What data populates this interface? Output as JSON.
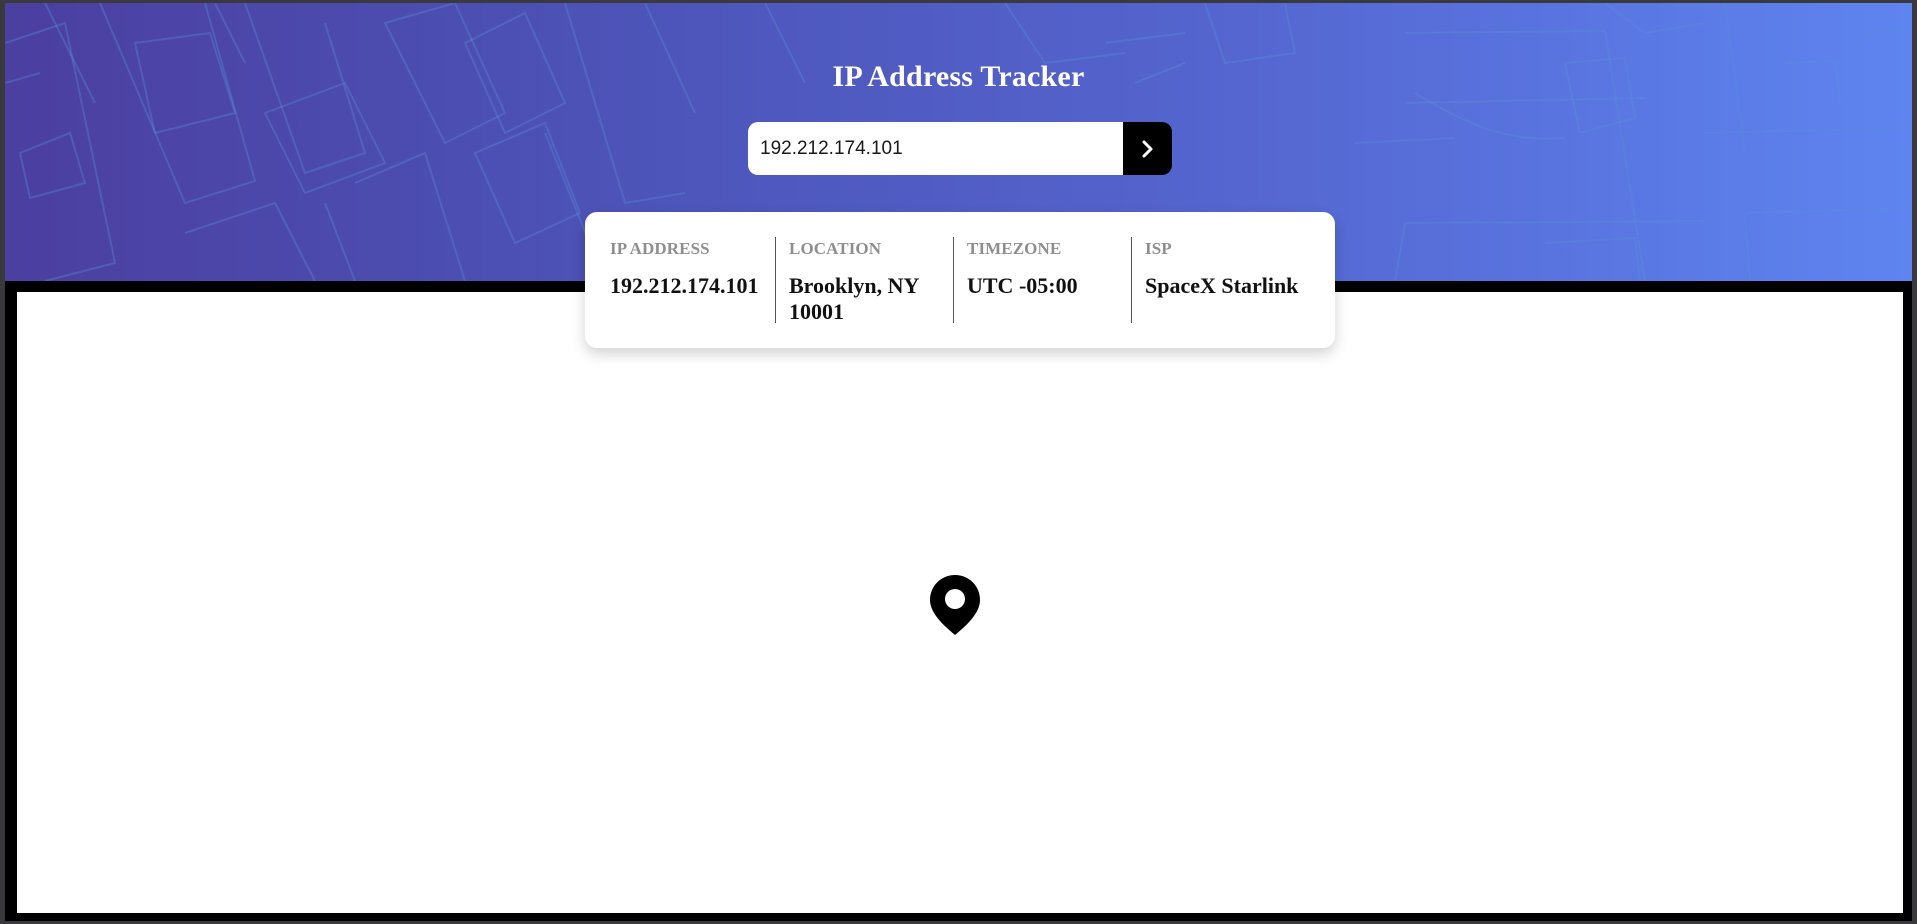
{
  "header": {
    "title": "IP Address Tracker"
  },
  "search": {
    "value": "192.212.174.101",
    "button_icon": "chevron-right-icon"
  },
  "info": {
    "ip": {
      "label": "IP ADDRESS",
      "value": "192.212.174.101"
    },
    "location": {
      "label": "LOCATION",
      "value": "Brooklyn, NY 10001"
    },
    "timezone": {
      "label": "TIMEZONE",
      "value": "UTC -05:00"
    },
    "isp": {
      "label": "ISP",
      "value": "SpaceX Starlink"
    }
  },
  "map": {
    "marker_icon": "location-pin-icon"
  },
  "colors": {
    "gradient_start": "#4b3fa0",
    "gradient_end": "#5e84f0",
    "button": "#000000",
    "label": "#8e8e8e"
  }
}
